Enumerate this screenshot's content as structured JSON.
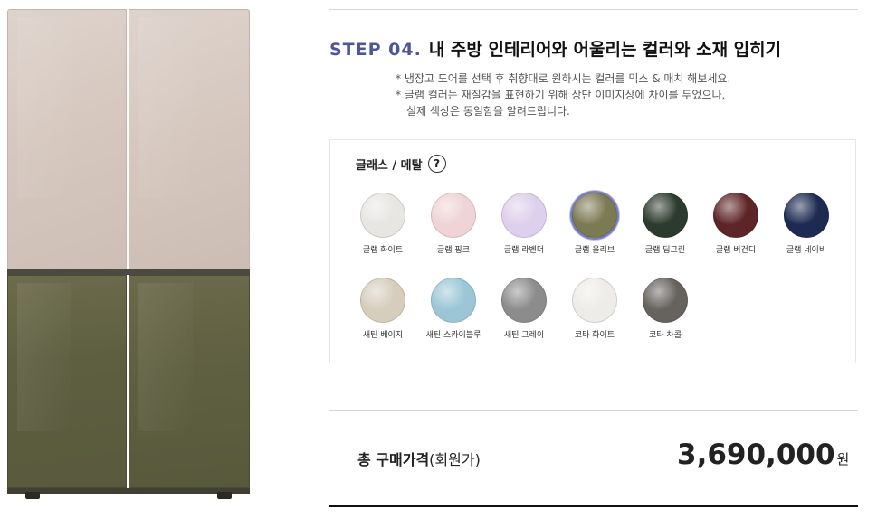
{
  "header": {
    "step_number": "STEP 04.",
    "step_title": "내 주방 인테리어와 어울리는 컬러와 소재 입히기"
  },
  "notes": [
    "* 냉장고 도어를 선택 후 취향대로 원하시는 컬러를 믹스 & 매치 해보세요.",
    "* 글램 컬러는 재질감을 표현하기 위해 상단 이미지상에 차이를 두었으나,",
    "실제 색상은 동일함을 알려드립니다."
  ],
  "palette": {
    "title": "글래스 / 메탈",
    "help_icon": "question-circle-icon",
    "help_glyph": "?",
    "swatches": [
      {
        "label": "글램 화이트",
        "color": "#e8e6e3"
      },
      {
        "label": "글램 핑크",
        "color": "#efd3d6"
      },
      {
        "label": "글램 라벤더",
        "color": "#ddd0ec"
      },
      {
        "label": "글램 올리브",
        "color": "#7c7a53",
        "selected": true
      },
      {
        "label": "글램 딥그린",
        "color": "#2d3b2e"
      },
      {
        "label": "글램 버건디",
        "color": "#5e2528"
      },
      {
        "label": "글램 네이비",
        "color": "#1d2a52"
      },
      {
        "label": "새틴 베이지",
        "color": "#d6cdbd"
      },
      {
        "label": "새틴 스카이블루",
        "color": "#9cc6d6"
      },
      {
        "label": "새틴 그레이",
        "color": "#8c8c8c"
      },
      {
        "label": "코타 화이트",
        "color": "#eeece8"
      },
      {
        "label": "코타 차콜",
        "color": "#66625e"
      }
    ]
  },
  "fridge": {
    "top_color": "#d8ccc4",
    "bottom_color": "#5f5f42"
  },
  "total": {
    "label": "총 구매가격",
    "label_sub": "(회원가)",
    "price": "3,690,000",
    "currency": "원"
  },
  "colors": {
    "accent": "#4a5799"
  }
}
